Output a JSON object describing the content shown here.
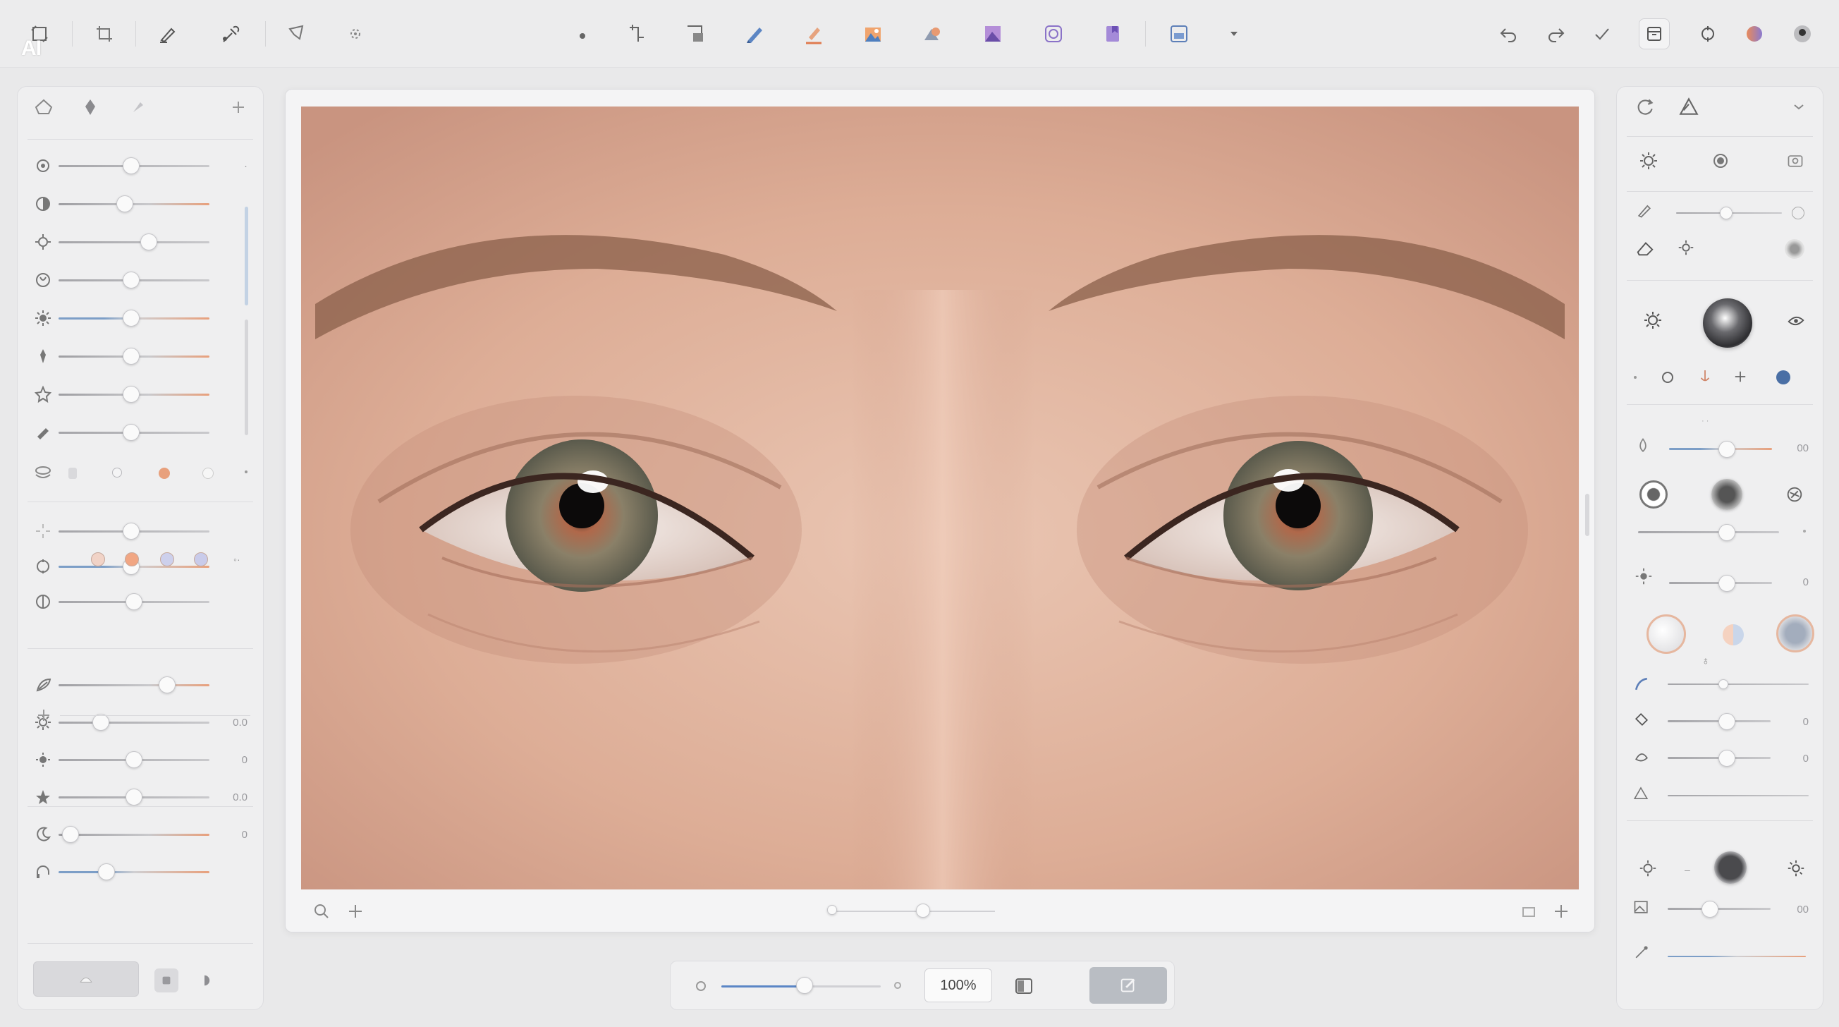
{
  "app": {
    "logo_text": "AI"
  },
  "toolbar": {
    "left_tools": [
      "select-tool-icon",
      "crop-tool-icon",
      "brush-tool-icon",
      "eyedropper-tool-icon",
      "lasso-tool-icon",
      "heal-tool-icon"
    ],
    "center_tools": [
      "dot-tool-icon",
      "transform-tool-icon",
      "resize-tool-icon",
      "pen-tool-icon",
      "marker-tool-icon",
      "image-tool-icon",
      "shapes-tool-icon",
      "gradient-image-icon",
      "circle-mask-icon",
      "page-icon",
      "layers-icon",
      "dropdown-icon"
    ],
    "right_tools": [
      "undo-icon",
      "redo-icon",
      "check-icon",
      "export-icon",
      "compass-icon",
      "color-ball-icon",
      "profile-icon"
    ]
  },
  "left_panel": {
    "header_icons": [
      "home-icon",
      "pin-icon",
      "brush-small-icon",
      "plus-icon"
    ],
    "sliders": [
      {
        "icon": "exposure-icon",
        "value_pct": 48,
        "track": "plain",
        "label": "·"
      },
      {
        "icon": "contrast-icon",
        "value_pct": 44,
        "track": "warm",
        "label": ""
      },
      {
        "icon": "highlights-icon",
        "value_pct": 60,
        "track": "plain",
        "label": ""
      },
      {
        "icon": "shadows-icon",
        "value_pct": 48,
        "track": "plain",
        "label": ""
      },
      {
        "icon": "temperature-icon",
        "value_pct": 48,
        "track": "cool",
        "label": ""
      },
      {
        "icon": "tint-icon",
        "value_pct": 48,
        "track": "warm",
        "label": ""
      },
      {
        "icon": "vibrance-icon",
        "value_pct": 48,
        "track": "warm",
        "label": ""
      },
      {
        "icon": "saturation-icon",
        "value_pct": 48,
        "track": "plain",
        "label": ""
      }
    ],
    "sliders_b": [
      {
        "icon": "sparkle-icon",
        "value_pct": 48,
        "track": "plain",
        "label": ""
      },
      {
        "icon": "detail-icon",
        "value_pct": 48,
        "track": "cool",
        "label": ""
      },
      {
        "icon": "clarity-icon",
        "value_pct": 50,
        "track": "plain",
        "label": ""
      }
    ],
    "sliders_c": [
      {
        "icon": "feather-icon",
        "value_pct": 72,
        "track": "warm",
        "label": ""
      },
      {
        "icon": "sun-icon",
        "value_pct": 28,
        "track": "plain",
        "label": "0.0"
      },
      {
        "icon": "sun-small-icon",
        "value_pct": 50,
        "track": "plain",
        "label": "0"
      },
      {
        "icon": "star-icon",
        "value_pct": 50,
        "track": "plain",
        "label": "0.0"
      },
      {
        "icon": "moon-icon",
        "value_pct": 8,
        "track": "warm",
        "label": "0"
      },
      {
        "icon": "headphones-icon",
        "value_pct": 32,
        "track": "cool",
        "label": ""
      }
    ],
    "swatches": [
      "#f1d3c7",
      "#f1a683",
      "#cdd0ec",
      "#c9cbea"
    ],
    "footer_buttons": [
      "mask-button",
      "square-button",
      "half-circle-button"
    ]
  },
  "canvas": {
    "photo_alt": "Close-up portrait of eyes",
    "footer_left": [
      "zoom-in-icon",
      "plus-icon"
    ],
    "footer_right": [
      "fit-icon",
      "add-icon"
    ]
  },
  "bottom_bar": {
    "zoom_label": "100%",
    "zoom_slider_pct": 52
  },
  "right_panel": {
    "header_icons": [
      "refresh-icon",
      "prism-icon",
      "collapse-icon"
    ],
    "values": {
      "v1": "00",
      "v2": "00",
      "v3": "0",
      "v4": "0",
      "v5": "0",
      "v6": "00"
    }
  },
  "colors": {
    "accent": "#4a6fa5",
    "warm_accent": "#e8a07c",
    "cool_accent": "#7c9ec7",
    "skin": "#dcab94"
  }
}
